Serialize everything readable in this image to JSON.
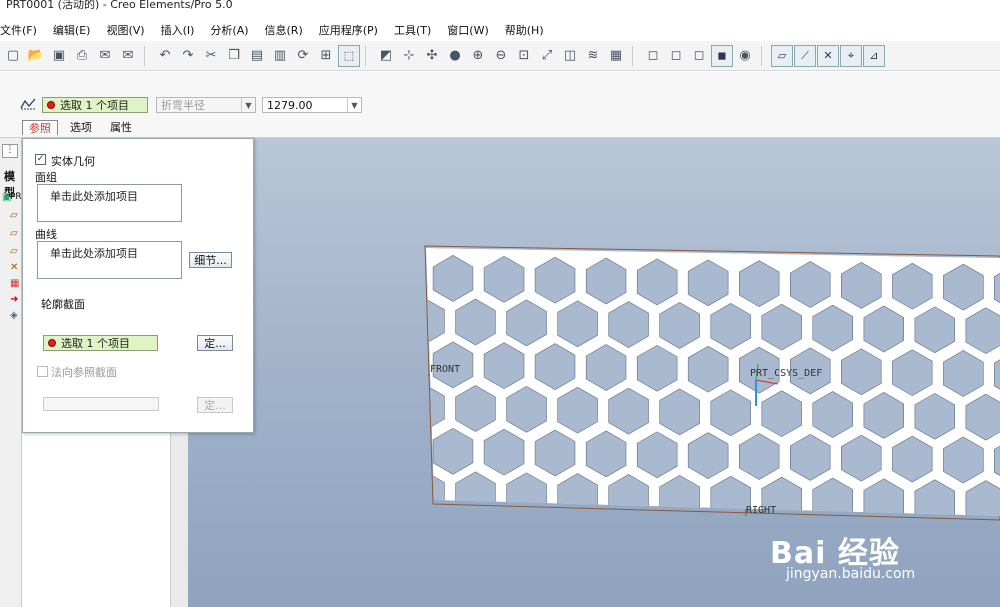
{
  "window": {
    "title": "PRT0001 (活动的) - Creo Elements/Pro 5.0"
  },
  "menu": [
    {
      "label": "文件(F)"
    },
    {
      "label": "编辑(E)"
    },
    {
      "label": "视图(V)"
    },
    {
      "label": "插入(I)"
    },
    {
      "label": "分析(A)"
    },
    {
      "label": "信息(R)"
    },
    {
      "label": "应用程序(P)"
    },
    {
      "label": "工具(T)"
    },
    {
      "label": "窗口(W)"
    },
    {
      "label": "帮助(H)"
    }
  ],
  "toolbar": {
    "icons": [
      "new-icon",
      "open-icon",
      "save-icon",
      "print-icon",
      "email-icon",
      "email2-icon",
      "undo-icon",
      "redo-icon",
      "cut-icon",
      "copy-icon",
      "paste-icon",
      "paste-special-icon",
      "regenerate-icon",
      "find-icon",
      "select-box-icon",
      "repaint-icon",
      "spin-center-icon",
      "orient-icon",
      "shading-icon",
      "zoom-in-icon",
      "zoom-out-icon",
      "refit-icon",
      "reorient-icon",
      "view-manager-icon",
      "layers-icon",
      "appearance-icon",
      "wireframe-icon",
      "hidden-line-icon",
      "no-hidden-icon",
      "shaded-icon",
      "enhanced-icon",
      "datum-plane-icon",
      "datum-axis-icon",
      "datum-point-icon",
      "csys-icon",
      "annotation-icon"
    ]
  },
  "dashboard": {
    "primary_selection": "选取 1 个项目",
    "bend_radius": {
      "placeholder": "折弯半径"
    },
    "thickness": {
      "value": "1279.00"
    },
    "tabs": [
      {
        "label": "参照",
        "active": true
      },
      {
        "label": "选项"
      },
      {
        "label": "属性"
      }
    ]
  },
  "left_tree": {
    "items": [
      "模型",
      "PR",
      "",
      "",
      "",
      "",
      "",
      ""
    ]
  },
  "panel": {
    "solid_geometry": {
      "label": "实体几何",
      "checked": true
    },
    "quilts": {
      "label": "面组",
      "placeholder": "单击此处添加项目"
    },
    "curves": {
      "label": "曲线",
      "placeholder": "单击此处添加项目",
      "details_button": "细节..."
    },
    "sketch_section": {
      "label": "轮廓截面",
      "selection": "选取 1 个项目",
      "define_button": "定..."
    },
    "normal_ref": {
      "label": "法向参照截面",
      "checked": false,
      "define_button": "定..."
    }
  },
  "graphics": {
    "datum_labels": {
      "front": "FRONT",
      "csys": "PRT_CSYS_DEF",
      "right": "RIGHT"
    }
  },
  "watermark": {
    "brand": "Bai 经验",
    "url": "jingyan.baidu.com"
  }
}
